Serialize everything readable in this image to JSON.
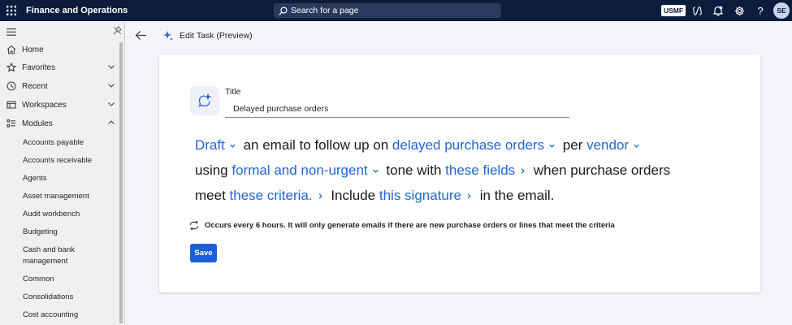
{
  "topbar": {
    "app_title": "Finance and Operations",
    "search_placeholder": "Search for a page",
    "company": "USMF",
    "avatar_initials": "SE",
    "icons": [
      "waffle-icon",
      "copilot-icon",
      "notifications-icon",
      "settings-icon",
      "help-icon"
    ]
  },
  "sidebar": {
    "nav": [
      {
        "label": "Home",
        "icon": "home-icon"
      },
      {
        "label": "Favorites",
        "icon": "star-icon",
        "expandable": true
      },
      {
        "label": "Recent",
        "icon": "clock-icon",
        "expandable": true
      },
      {
        "label": "Workspaces",
        "icon": "workspaces-icon",
        "expandable": true
      },
      {
        "label": "Modules",
        "icon": "modules-icon",
        "expanded": true
      }
    ],
    "modules": [
      "Accounts payable",
      "Accounts receivable",
      "Agents",
      "Asset management",
      "Audit workbench",
      "Budgeting",
      "Cash and bank management",
      "Common",
      "Consolidations",
      "Cost accounting"
    ]
  },
  "page": {
    "title": "Edit Task (Preview)"
  },
  "card": {
    "title_label": "Title",
    "title_value": "Delayed purchase orders",
    "sentence": {
      "action": "Draft",
      "t1": "an email to follow up on",
      "subject": "delayed purchase orders",
      "t2": "per",
      "group_by": "vendor",
      "t3": "using",
      "tone": "formal and non-urgent",
      "t4": "tone with",
      "fields": "these fields",
      "t5": "when purchase orders",
      "t6": "meet",
      "criteria": "these criteria.",
      "t7": "Include",
      "signature": "this signature",
      "t8": "in the email."
    },
    "schedule_text": "Occurs every 6 hours. It will only generate emails if there are new purchase orders or lines that meet the criteria",
    "save_label": "Save"
  },
  "colors": {
    "topbar_bg": "#0b1c3d",
    "token_blue": "#2266d4",
    "save_blue": "#1d5ed8"
  }
}
